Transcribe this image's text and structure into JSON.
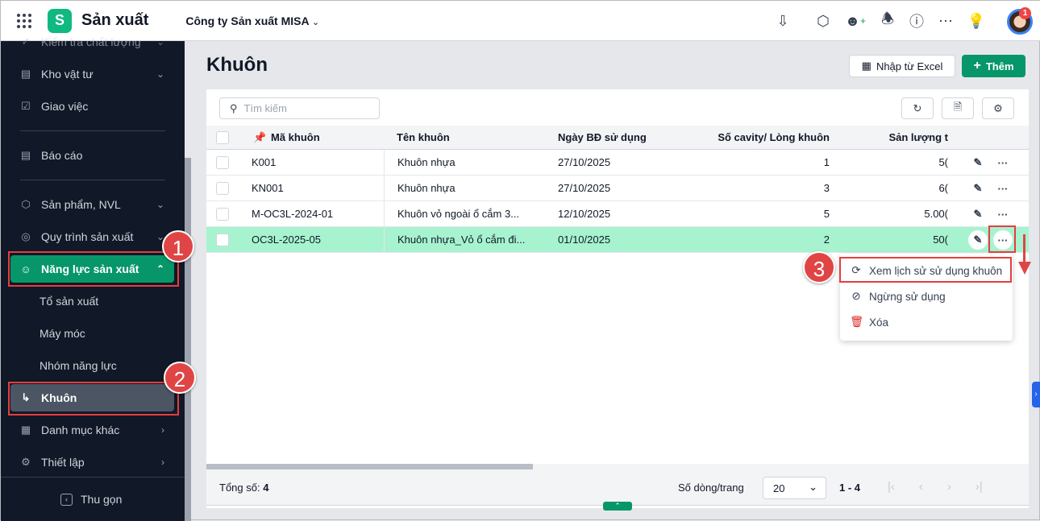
{
  "header": {
    "app_title": "Sản xuất",
    "company": "Công ty Sản xuất MISA",
    "notification_count": "1"
  },
  "sidebar": {
    "items": [
      {
        "label": "Kiểm tra chất lượng",
        "icon": "check-shield-icon"
      },
      {
        "label": "Kho vật tư",
        "icon": "archive-icon"
      },
      {
        "label": "Giao việc",
        "icon": "clipboard-icon"
      },
      {
        "label": "Báo cáo",
        "icon": "chart-icon"
      },
      {
        "label": "Sản phẩm, NVL",
        "icon": "cube-icon"
      },
      {
        "label": "Quy trình sản xuất",
        "icon": "process-icon"
      },
      {
        "label": "Năng lực sản xuất",
        "icon": "user-gear-icon"
      },
      {
        "label": "Tổ sản xuất"
      },
      {
        "label": "Máy móc"
      },
      {
        "label": "Nhóm năng lực"
      },
      {
        "label": "Khuôn"
      },
      {
        "label": "Danh mục khác",
        "icon": "grid-icon"
      },
      {
        "label": "Thiết lập",
        "icon": "gear-icon"
      }
    ],
    "collapse_label": "Thu gọn"
  },
  "annotations": [
    "1",
    "2",
    "3"
  ],
  "page": {
    "title": "Khuôn",
    "import_label": "Nhập từ Excel",
    "add_label": "Thêm",
    "search_placeholder": "Tìm kiếm"
  },
  "table": {
    "columns": [
      "Mã khuôn",
      "Tên khuôn",
      "Ngày BĐ sử dụng",
      "Số cavity/ Lòng khuôn",
      "Sản lượng t"
    ],
    "rows": [
      {
        "code": "K001",
        "name": "Khuôn nhựa",
        "date": "27/10/2025",
        "cavity": "1",
        "output": "5("
      },
      {
        "code": "KN001",
        "name": "Khuôn nhựa",
        "date": "27/10/2025",
        "cavity": "3",
        "output": "6("
      },
      {
        "code": "M-OC3L-2024-01",
        "name": "Khuôn vỏ ngoài ổ cắm 3...",
        "date": "12/10/2025",
        "cavity": "5",
        "output": "5.00("
      },
      {
        "code": "OC3L-2025-05",
        "name": "Khuôn nhựa_Vỏ ổ cắm đi...",
        "date": "01/10/2025",
        "cavity": "2",
        "output": "50("
      }
    ]
  },
  "context_menu": {
    "items": [
      "Xem lịch sử sử dụng khuôn",
      "Ngừng sử dụng",
      "Xóa"
    ]
  },
  "footer": {
    "total_label": "Tổng số:",
    "total": "4",
    "page_size_label": "Số dòng/trang",
    "page_size": "20",
    "range": "1 - 4"
  },
  "colors": {
    "primary": "#079669",
    "selected_row": "#a7f3d0",
    "sidebar": "#111827",
    "annotation": "#e04545"
  }
}
